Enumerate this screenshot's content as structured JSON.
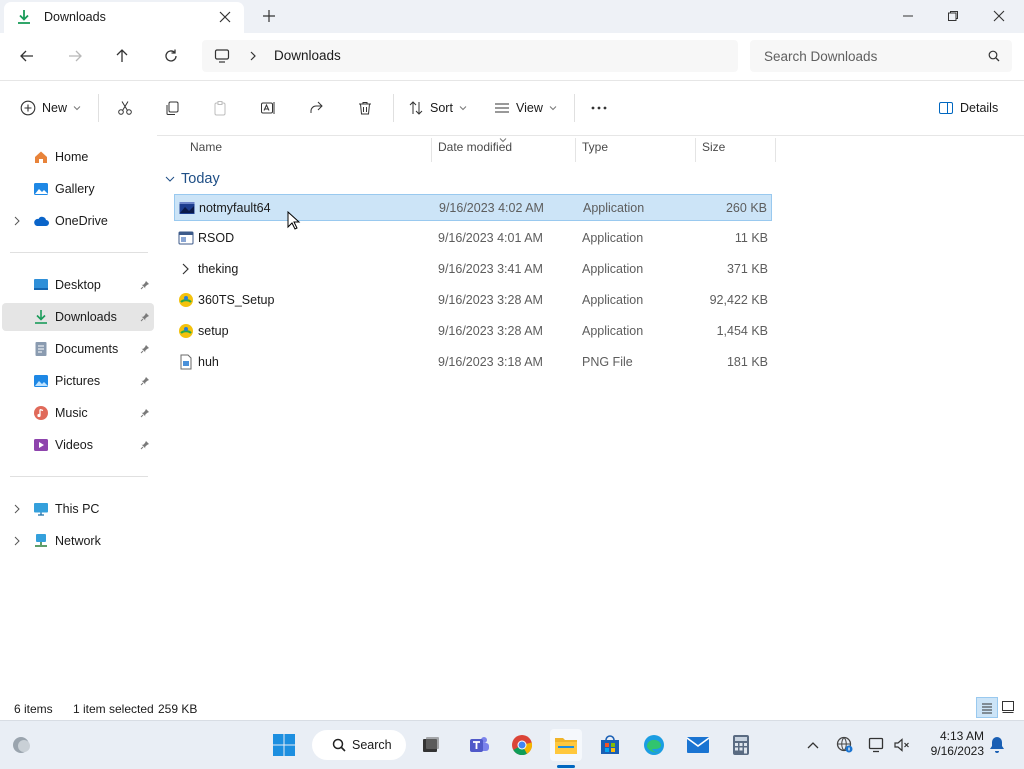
{
  "window": {
    "tab_title": "Downloads",
    "new_tab_icon": "plus-icon"
  },
  "nav": {
    "breadcrumb": [
      "Downloads"
    ],
    "search_placeholder": "Search Downloads"
  },
  "toolbar": {
    "new_label": "New",
    "sort_label": "Sort",
    "view_label": "View",
    "details_label": "Details"
  },
  "sidebar": {
    "quick": [
      {
        "label": "Home",
        "icon": "home-icon"
      },
      {
        "label": "Gallery",
        "icon": "gallery-icon"
      },
      {
        "label": "OneDrive",
        "icon": "cloud-icon"
      }
    ],
    "pinned": [
      {
        "label": "Desktop",
        "icon": "desktop-icon"
      },
      {
        "label": "Downloads",
        "icon": "download-icon"
      },
      {
        "label": "Documents",
        "icon": "document-icon"
      },
      {
        "label": "Pictures",
        "icon": "picture-icon"
      },
      {
        "label": "Music",
        "icon": "music-icon"
      },
      {
        "label": "Videos",
        "icon": "video-icon"
      }
    ],
    "devices": [
      {
        "label": "This PC",
        "icon": "pc-icon"
      },
      {
        "label": "Network",
        "icon": "network-icon"
      }
    ]
  },
  "list": {
    "columns": [
      "Name",
      "Date modified",
      "Type",
      "Size"
    ],
    "group": "Today",
    "rows": [
      {
        "name": "notmyfault64",
        "date": "9/16/2023 4:02 AM",
        "type": "Application",
        "size": "260 KB"
      },
      {
        "name": "RSOD",
        "date": "9/16/2023 4:01 AM",
        "type": "Application",
        "size": "11 KB"
      },
      {
        "name": "theking",
        "date": "9/16/2023 3:41 AM",
        "type": "Application",
        "size": "371 KB"
      },
      {
        "name": "360TS_Setup",
        "date": "9/16/2023 3:28 AM",
        "type": "Application",
        "size": "92,422 KB"
      },
      {
        "name": "setup",
        "date": "9/16/2023 3:28 AM",
        "type": "Application",
        "size": "1,454 KB"
      },
      {
        "name": "huh",
        "date": "9/16/2023 3:18 AM",
        "type": "PNG File",
        "size": "181 KB"
      }
    ]
  },
  "status": {
    "count": "6 items",
    "selection": "1 item selected",
    "selection_size": "259 KB"
  },
  "taskbar": {
    "search_label": "Search",
    "time": "4:13 AM",
    "date": "9/16/2023"
  },
  "colors": {
    "selection": "#cce4f7",
    "accent": "#0067c0"
  }
}
